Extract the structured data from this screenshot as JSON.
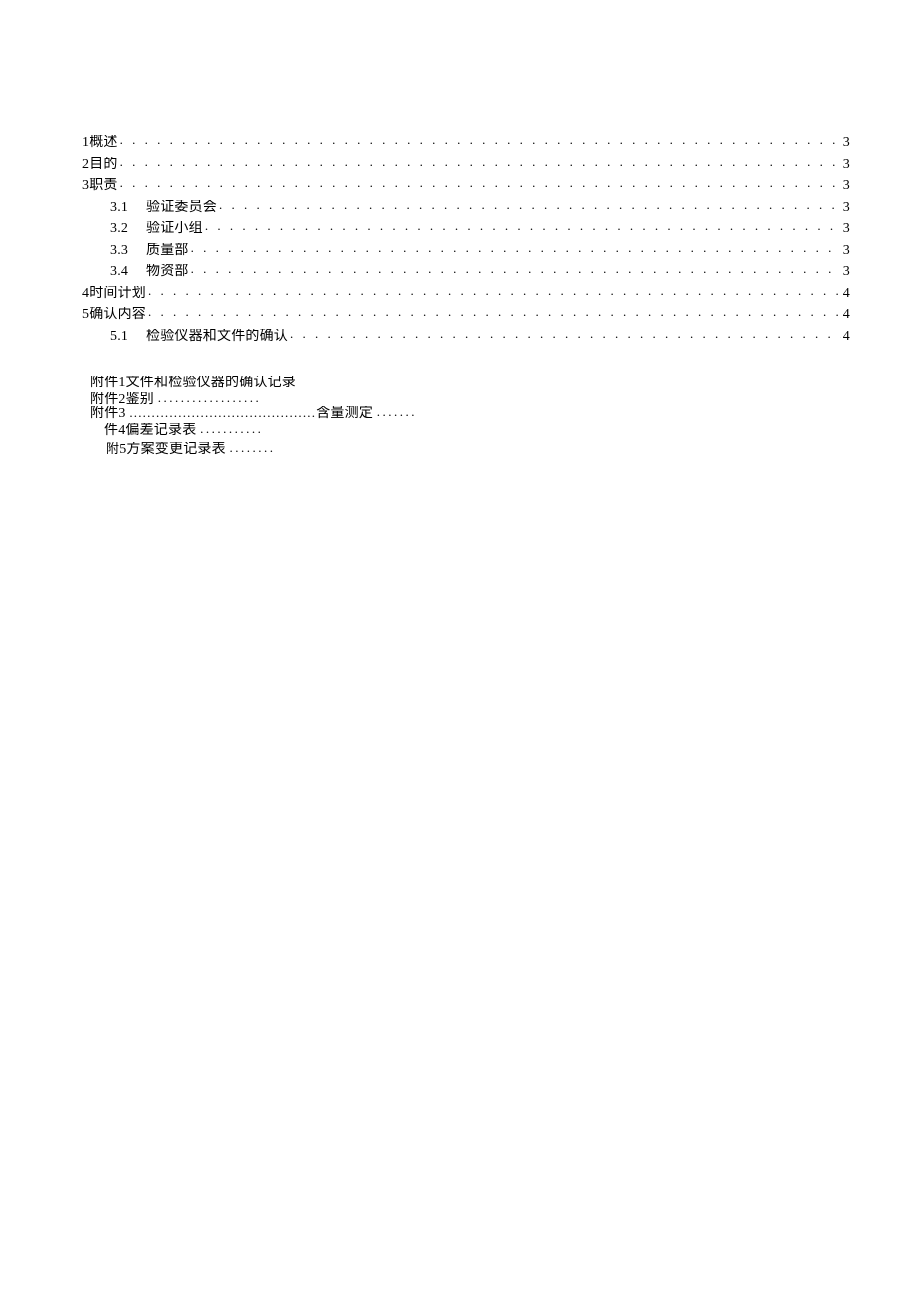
{
  "toc": [
    {
      "indent": false,
      "num": "1",
      "title": "概述",
      "page": "3"
    },
    {
      "indent": false,
      "num": "2",
      "title": "目的",
      "page": "3"
    },
    {
      "indent": false,
      "num": "3",
      "title": "职责",
      "page": "3"
    },
    {
      "indent": true,
      "num": "3.1",
      "title": "验证委员会",
      "page": "3"
    },
    {
      "indent": true,
      "num": "3.2",
      "title": "验证小组",
      "page": "3"
    },
    {
      "indent": true,
      "num": "3.3",
      "title": "质量部",
      "page": "3"
    },
    {
      "indent": true,
      "num": "3.4",
      "title": "物资部",
      "page": "3"
    },
    {
      "indent": false,
      "num": "4",
      "title": "时间计划",
      "page": "4"
    },
    {
      "indent": false,
      "num": "5",
      "title": "确认内容",
      "page": "4"
    },
    {
      "indent": true,
      "num": "5.1",
      "title": "检验仪器和文件的确认",
      "page": "4"
    }
  ],
  "attachments": {
    "a1_prefix": "附件1",
    "a1_text": "文件和检验仪器的确认记录",
    "a2_prefix": "附件",
    "a2_num": "2",
    "a2_text": "鉴别",
    "a2_dots": "..................",
    "a3_prefix": "附件",
    "a3_num": "3",
    "a3_dots1": "..........................................",
    "a3_text": "含量测定",
    "a3_dots2": ".......",
    "a4_prefix": "件4",
    "a4_text": "偏差记录表",
    "a4_dots": "...........",
    "a5_prefix1": "附",
    "a5_prefix2": "5",
    "a5_text": "方案变更记录表",
    "a5_dots": "........"
  }
}
